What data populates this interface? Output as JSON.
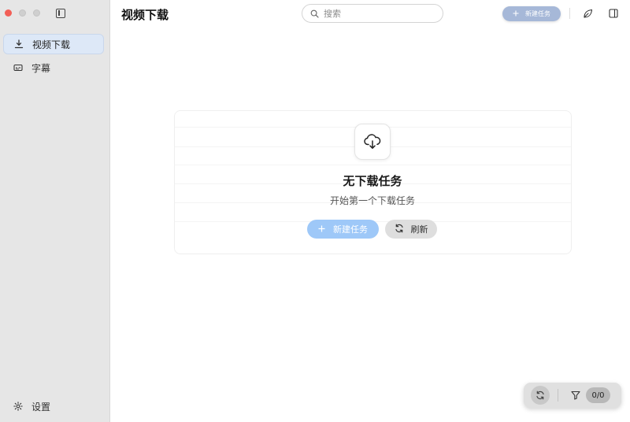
{
  "sidebar": {
    "items": [
      {
        "label": "视频下载",
        "icon": "download-icon",
        "active": true
      },
      {
        "label": "字幕",
        "icon": "subtitle-icon",
        "active": false
      }
    ],
    "settings_label": "设置"
  },
  "header": {
    "title": "视频下载",
    "search_placeholder": "搜索",
    "new_task_label": "新建任务"
  },
  "empty_state": {
    "title": "无下载任务",
    "subtitle": "开始第一个下载任务",
    "new_task_label": "新建任务",
    "refresh_label": "刷新"
  },
  "footer_bar": {
    "count": "0/0"
  },
  "colors": {
    "accent": "#9ec8f8",
    "accent_muted": "#a6b8d8",
    "sidebar_bg": "#e6e6e6",
    "active_item_bg": "#dde8f7",
    "close_dot": "#f25f57"
  }
}
